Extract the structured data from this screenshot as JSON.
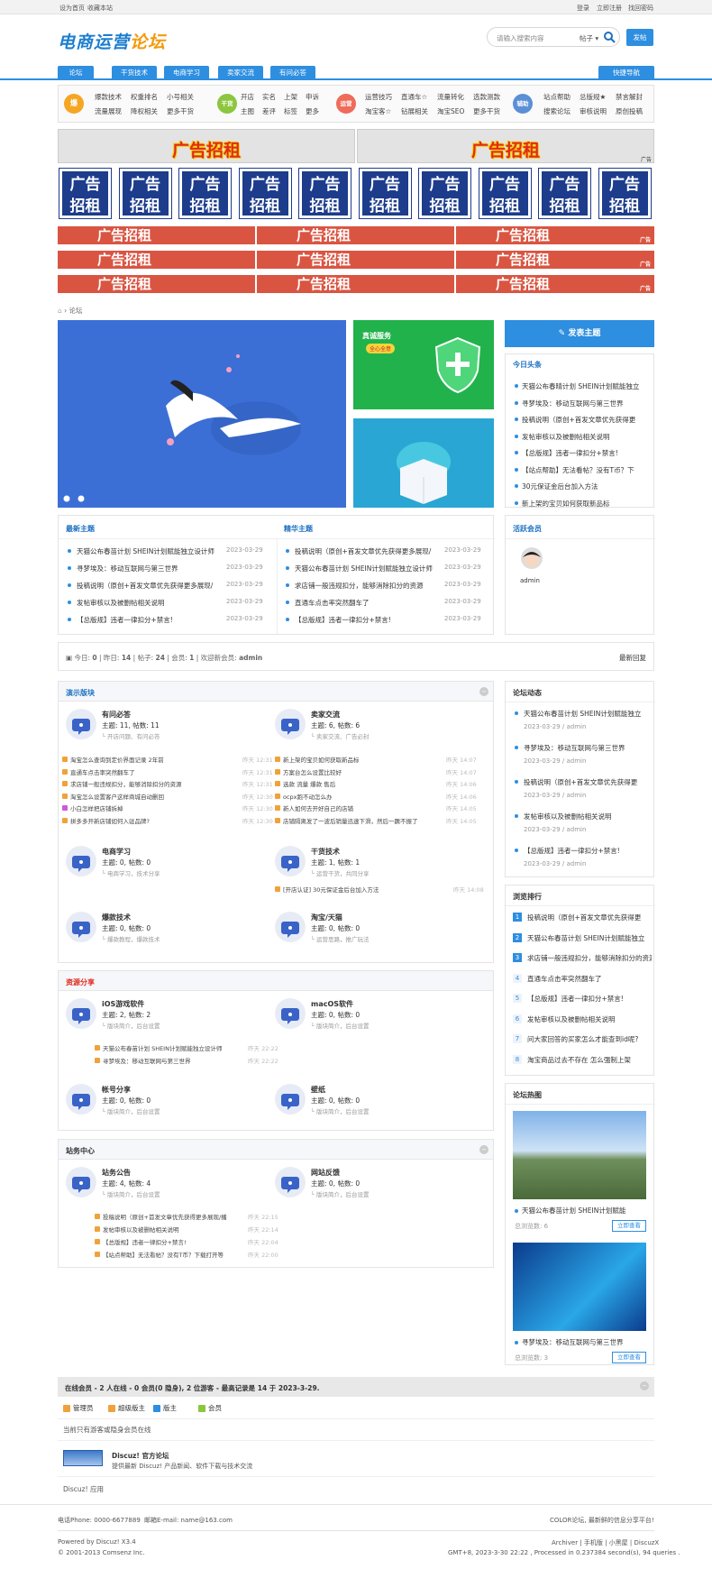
{
  "topbar": {
    "home": "设为首页",
    "fav": "收藏本站",
    "login": "登录",
    "register": "立即注册",
    "forgot": "找回密码"
  },
  "logo": {
    "a": "电商运营",
    "b": "论坛"
  },
  "search": {
    "placeholder": "请输入搜索内容",
    "type": "帖子",
    "post": "发帖"
  },
  "nav": {
    "tabs": [
      "论坛",
      "干货技术",
      "电商学习",
      "卖家交流",
      "有问必答"
    ],
    "quick": "快捷导航"
  },
  "quick": {
    "g1": {
      "icon": "爆",
      "links": [
        "爆款技术",
        "权重排名",
        "小号相关",
        "流量展现",
        "降权相关",
        "更多干货"
      ]
    },
    "g2": {
      "icon": "干货",
      "links": [
        "开店",
        "实名",
        "上架",
        "申诉",
        "主图",
        "差评",
        "标签",
        "更多"
      ]
    },
    "g3": {
      "icon": "运营",
      "links": [
        "运营技巧",
        "直通车☆",
        "流量转化",
        "选款测款",
        "淘宝客☆",
        "钻展相关",
        "淘宝SEO",
        "更多干货"
      ]
    },
    "g4": {
      "icon": "辅助",
      "links": [
        "站点帮助",
        "总版规★",
        "禁言解封",
        "搜索论坛",
        "审核说明",
        "原创投稿"
      ]
    }
  },
  "ads": {
    "text": "广告招租",
    "a": "广",
    "b": "告",
    "c": "招",
    "d": "租",
    "tag": "广告"
  },
  "breadcrumb": {
    "home": "⌂",
    "forum": "论坛"
  },
  "promo": {
    "title": "真诚服务",
    "sub": "全心全意"
  },
  "post_topic": "发表主题",
  "today": {
    "title": "今日头条",
    "items": [
      "天猫公布春晴计划 SHEIN计划赋能独立",
      "寻梦埃及：移动互联网与第三世界",
      "投稿说明（原创+首发文章优先获得更",
      "发帖审核以及被删帖相关说明",
      "【总版规】违者一律扣分+禁言!",
      "【站点帮助】无法看帖？没有T币？下",
      "30元保证金后台加入方法",
      "新上架的宝贝如何获取新品标"
    ]
  },
  "newtopics": {
    "title": "最新主题",
    "items": [
      {
        "t": "天猫公布春苗计划 SHEIN计划赋能独立设计师",
        "d": "2023-03-29"
      },
      {
        "t": "寻梦埃及：移动互联网与第三世界",
        "d": "2023-03-29"
      },
      {
        "t": "投稿说明（原创+首发文章优先获得更多展现/",
        "d": "2023-03-29"
      },
      {
        "t": "发帖审核以及被删帖相关说明",
        "d": "2023-03-29"
      },
      {
        "t": "【总版规】违者一律扣分+禁言!",
        "d": "2023-03-29"
      }
    ]
  },
  "best": {
    "title": "精华主题",
    "items": [
      {
        "t": "投稿说明（原创+首发文章优先获得更多展现/",
        "d": "2023-03-29"
      },
      {
        "t": "天猫公布春苗计划 SHEIN计划赋能独立设计师",
        "d": "2023-03-29"
      },
      {
        "t": "求店铺一般违规扣分，能够消除扣分的资源",
        "d": "2023-03-29"
      },
      {
        "t": "直通车点击率突然翻车了",
        "d": "2023-03-29"
      },
      {
        "t": "【总版规】违者一律扣分+禁言!",
        "d": "2023-03-29"
      }
    ]
  },
  "active": {
    "title": "活跃会员",
    "user": "admin"
  },
  "stats": {
    "today": "今日: ",
    "tv": "0",
    "yest": "昨日: ",
    "yv": "14",
    "posts": "帖子: ",
    "pv": "24",
    "members": "会员: ",
    "mv": "1",
    "welcome": "欢迎新会员: ",
    "wv": "admin",
    "latest": "最新回复"
  },
  "demo": {
    "title": "演示版块",
    "f1": {
      "name": "有问必答",
      "stat": "主题: 11, 帖数: 11",
      "desc": "└ 开店问题、有问必答"
    },
    "f2": {
      "name": "卖家交流",
      "stat": "主题: 6, 帖数: 6",
      "desc": "└ 卖家交流、广告必封"
    },
    "l1": [
      {
        "t": "淘宝怎么查询到定价界面记录 2年前",
        "d": "昨天 12:31",
        "c": "#f0a23a"
      },
      {
        "t": "直通车点击率突然翻车了",
        "d": "昨天 12:31",
        "c": "#f0a23a"
      },
      {
        "t": "求店铺一般违规扣分，能够消除扣分的资源",
        "d": "昨天 12:31",
        "c": "#f0a23a"
      },
      {
        "t": "淘宝怎么设置客户这样商城自动删回",
        "d": "昨天 12:30",
        "c": "#f0a23a"
      },
      {
        "t": "小白怎样把店铺拆掉",
        "d": "昨天 12:30",
        "c": "#cc5ad8"
      },
      {
        "t": "拼多多开新店铺如何入驻品牌?",
        "d": "昨天 12:30",
        "c": "#f0a23a"
      }
    ],
    "l2": [
      {
        "t": "新上架的宝贝如何获取新品标",
        "d": "昨天 14:07",
        "c": "#f0a23a"
      },
      {
        "t": "方案台怎么设置比较好",
        "d": "昨天 14:07",
        "c": "#f0a23a"
      },
      {
        "t": "选款 流量 爆款 售后",
        "d": "昨天 14:06",
        "c": "#f0a23a"
      },
      {
        "t": "ocpx跑不动怎么办",
        "d": "昨天 14:06",
        "c": "#f0a23a"
      },
      {
        "t": "新人如何去开好自己的店铺",
        "d": "昨天 14:05",
        "c": "#f0a23a"
      },
      {
        "t": "店铺隔离发了一波后销量迅速下滑，然后一蹶不振了",
        "d": "昨天 14:05",
        "c": "#f0a23a"
      }
    ],
    "f3": {
      "name": "电商学习",
      "stat": "主题: 0, 帖数: 0",
      "desc": "└ 电商学习，技术分享"
    },
    "f4": {
      "name": "干货技术",
      "stat": "主题: 1, 帖数: 1",
      "desc": "└ 运营干货，共同分享"
    },
    "f4post": {
      "t": "[开店认证] 30元保证金后台加入方法",
      "d": "昨天 14:08"
    },
    "f5": {
      "name": "爆款技术",
      "stat": "主题: 0, 帖数: 0",
      "desc": "└ 爆款教程，爆款技术"
    },
    "f6": {
      "name": "淘宝/天猫",
      "stat": "主题: 0, 帖数: 0",
      "desc": "└ 运营思路，推广玩法"
    }
  },
  "res": {
    "title": "资源分享",
    "f1": {
      "name": "iOS游戏软件",
      "stat": "主题: 2, 帖数: 2",
      "desc": "└ 版块简介，后台设置"
    },
    "f2": {
      "name": "macOS软件",
      "stat": "主题: 0, 帖数: 0",
      "desc": "└ 版块简介，后台设置"
    },
    "l1": [
      {
        "t": "天猫公布春苗计划 SHEIN计划赋能独立设计师",
        "d": "昨天 22:22"
      },
      {
        "t": "寻梦埃及：移动互联网与第三世界",
        "d": "昨天 22:22"
      }
    ],
    "f3": {
      "name": "帐号分享",
      "stat": "主题: 0, 帖数: 0",
      "desc": "└ 版块简介，后台设置"
    },
    "f4": {
      "name": "壁纸",
      "stat": "主题: 0, 帖数: 0",
      "desc": "└ 版块简介，后台设置"
    }
  },
  "site": {
    "title": "站务中心",
    "f1": {
      "name": "站务公告",
      "stat": "主题: 4, 帖数: 4",
      "desc": "└ 版块简介，后台设置"
    },
    "f2": {
      "name": "网站反馈",
      "stat": "主题: 0, 帖数: 0",
      "desc": "└ 版块简介，后台设置"
    },
    "l1": [
      {
        "t": "投稿说明（原创+首发文章优先获得更多展现/播",
        "d": "昨天 22:15"
      },
      {
        "t": "发帖审核以及被删帖相关说明",
        "d": "昨天 22:14"
      },
      {
        "t": "【总版规】违者一律扣分+禁言!",
        "d": "昨天 22:04"
      },
      {
        "t": "【站点帮助】无法看帖？没有T币？下载打开等",
        "d": "昨天 22:00"
      }
    ]
  },
  "dyn": {
    "title": "论坛动态",
    "items": [
      {
        "t": "天猫公布春苗计划 SHEIN计划赋能独立",
        "m": "2023-03-29 / admin"
      },
      {
        "t": "寻梦埃及：移动互联网与第三世界",
        "m": "2023-03-29 / admin"
      },
      {
        "t": "投稿说明（原创+首发文章优先获得更",
        "m": "2023-03-29 / admin"
      },
      {
        "t": "发帖审核以及被删帖相关说明",
        "m": "2023-03-29 / admin"
      },
      {
        "t": "【总版规】违者一律扣分+禁言!",
        "m": "2023-03-29 / admin"
      }
    ]
  },
  "rank": {
    "title": "浏览排行",
    "items": [
      "投稿说明（原创+首发文章优先获得更",
      "天猫公布春苗计划 SHEIN计划赋能独立",
      "求店铺一般违规扣分，能够消除扣分的资源",
      "直通车点击率突然翻车了",
      "【总版规】违者一律扣分+禁言!",
      "发帖审核以及被删帖相关说明",
      "问大家回答的买家怎么才能查到id呢?",
      "淘宝商品过去不存在 怎么强制上架"
    ],
    "nums": [
      "1",
      "2",
      "3",
      "4",
      "5",
      "6",
      "7",
      "8"
    ]
  },
  "hot": {
    "title": "论坛热图",
    "p1": {
      "t": "天猫公布春苗计划 SHEIN计划赋能",
      "views": "总浏览数: 6",
      "btn": "立即查看"
    },
    "p2": {
      "t": "寻梦埃及：移动互联网与第三世界",
      "views": "总浏览数: 3",
      "btn": "立即查看"
    }
  },
  "online": {
    "title": "在线会员 - 2 人在线 - 0 会员(0 隐身), 2 位游客 - 最高记录是 14 于 2023-3-29.",
    "roles": [
      "管理员",
      "超级版主",
      "版主",
      "会员"
    ],
    "note": "当前只有游客或隐身会员在线"
  },
  "link": {
    "name": "Discuz! 官方论坛",
    "desc": "提供最新 Discuz! 产品新闻、软件下载与技术交流",
    "app": "Discuz! 应用"
  },
  "footer": {
    "phone": "电话Phone: 0000-6677889",
    "email": "邮箱E-mail: name@163.com",
    "slogan": "COLOR论坛, 最新鲜的信息分享平台!",
    "powered": "Powered by Discuz! X3.4",
    "copy": "© 2001-2013 Comsenz Inc.",
    "links": "Archiver | 手机版 | 小黑屋 | DiscuzX",
    "gmt": "GMT+8, 2023-3-30 22:22 , Processed in 0.237384 second(s), 94 queries ."
  },
  "colors": {
    "blue": "#2e8ee0",
    "red": "#d95542",
    "navy": "#1d3c8c"
  }
}
